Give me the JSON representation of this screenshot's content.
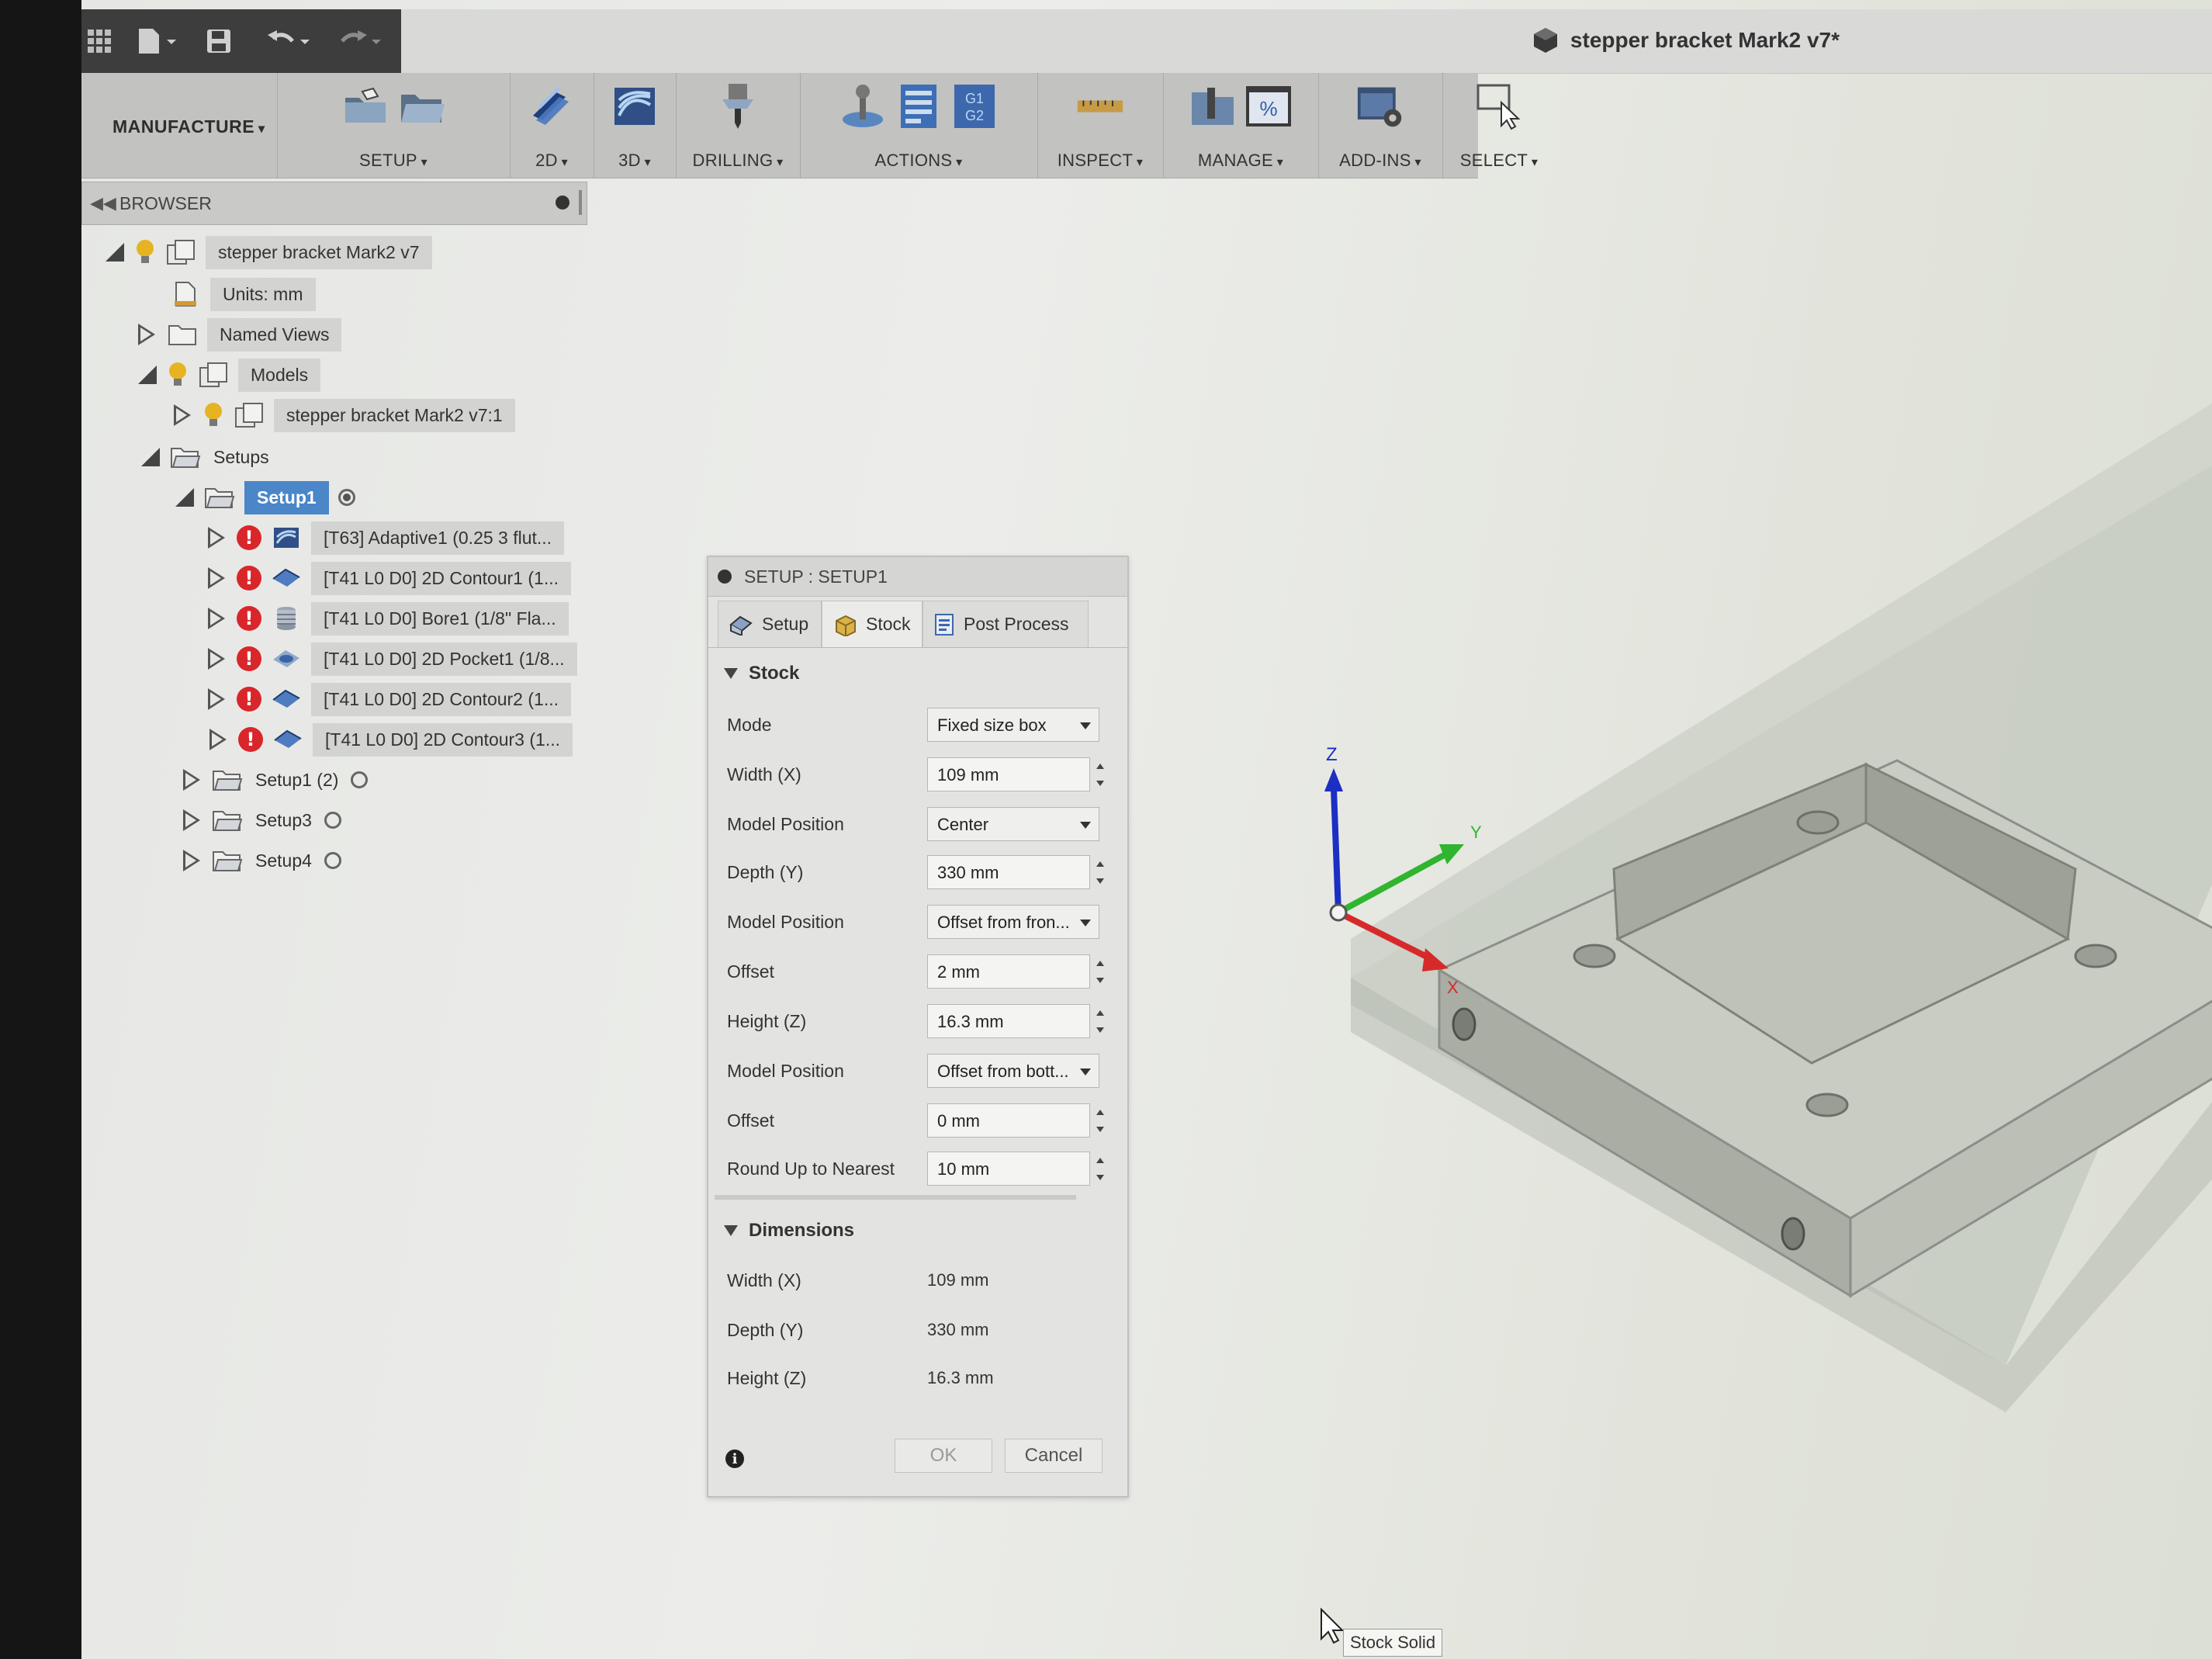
{
  "app": {
    "document_title": "stepper bracket Mark2 v7*"
  },
  "ribbon": {
    "workspace": "MANUFACTURE",
    "groups": [
      {
        "label": "SETUP"
      },
      {
        "label": "2D"
      },
      {
        "label": "3D"
      },
      {
        "label": "DRILLING"
      },
      {
        "label": "ACTIONS"
      },
      {
        "label": "INSPECT"
      },
      {
        "label": "MANAGE"
      },
      {
        "label": "ADD-INS"
      },
      {
        "label": "SELECT"
      }
    ],
    "nc_icon_text": "G1\nG2"
  },
  "browser": {
    "title": "BROWSER",
    "root": "stepper bracket Mark2 v7",
    "units": "Units: mm",
    "named_views": "Named Views",
    "models": "Models",
    "model_item": "stepper bracket Mark2 v7:1",
    "setups": "Setups",
    "setup1": "Setup1",
    "operations": [
      "[T63] Adaptive1 (0.25 3 flut...",
      "[T41 L0 D0] 2D Contour1 (1...",
      "[T41 L0 D0] Bore1 (1/8\" Fla...",
      "[T41 L0 D0] 2D Pocket1 (1/8...",
      "[T41 L0 D0] 2D Contour2 (1...",
      "[T41 L0 D0] 2D Contour3 (1..."
    ],
    "other_setups": [
      "Setup1 (2)",
      "Setup3",
      "Setup4"
    ]
  },
  "dialog": {
    "title": "SETUP : SETUP1",
    "tabs": {
      "setup": "Setup",
      "stock": "Stock",
      "post": "Post Process"
    },
    "stock_section": "Stock",
    "fields": {
      "mode_label": "Mode",
      "mode_value": "Fixed size box",
      "width_label": "Width (X)",
      "width_value": "109 mm",
      "modelpos1_label": "Model Position",
      "modelpos1_value": "Center",
      "depth_label": "Depth (Y)",
      "depth_value": "330 mm",
      "modelpos2_label": "Model Position",
      "modelpos2_value": "Offset from fron...",
      "offset1_label": "Offset",
      "offset1_value": "2 mm",
      "height_label": "Height (Z)",
      "height_value": "16.3 mm",
      "modelpos3_label": "Model Position",
      "modelpos3_value": "Offset from bott...",
      "offset2_label": "Offset",
      "offset2_value": "0 mm",
      "round_label": "Round Up to Nearest",
      "round_value": "10 mm"
    },
    "dimensions_section": "Dimensions",
    "dimensions": {
      "width_label": "Width (X)",
      "width_value": "109 mm",
      "depth_label": "Depth (Y)",
      "depth_value": "330 mm",
      "height_label": "Height (Z)",
      "height_value": "16.3 mm"
    },
    "ok": "OK",
    "cancel": "Cancel"
  },
  "viewport": {
    "axis_z": "Z",
    "axis_y": "Y",
    "axis_x": "X",
    "tooltip": "Stock Solid"
  },
  "colors": {
    "accent_selection": "#4a86c8",
    "error_red": "#d9262b",
    "axis_x": "#d62a2a",
    "axis_y": "#2fb52f",
    "axis_z": "#1b2fc4"
  }
}
